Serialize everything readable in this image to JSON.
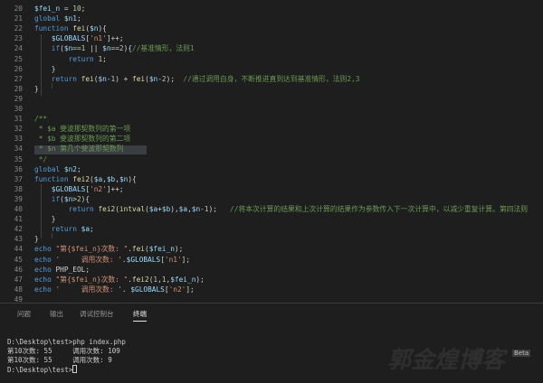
{
  "editor": {
    "lines": [
      {
        "n": "20",
        "tokens": [
          [
            "var",
            "$fei_n"
          ],
          [
            "op",
            " = "
          ],
          [
            "num",
            "10"
          ],
          [
            "op",
            ";"
          ]
        ]
      },
      {
        "n": "21",
        "tokens": [
          [
            "kw",
            "global"
          ],
          [
            "op",
            " "
          ],
          [
            "var",
            "$n1"
          ],
          [
            "op",
            ";"
          ]
        ]
      },
      {
        "n": "22",
        "tokens": [
          [
            "kw",
            "function"
          ],
          [
            "op",
            " "
          ],
          [
            "fn",
            "fei"
          ],
          [
            "op",
            "("
          ],
          [
            "var",
            "$n"
          ],
          [
            "op",
            "){"
          ]
        ]
      },
      {
        "n": "23",
        "tokens": [
          [
            "op",
            "    "
          ],
          [
            "var",
            "$GLOBALS"
          ],
          [
            "op",
            "["
          ],
          [
            "str",
            "'n1'"
          ],
          [
            "op",
            "]++;"
          ]
        ]
      },
      {
        "n": "24",
        "tokens": [
          [
            "op",
            "    "
          ],
          [
            "kw",
            "if"
          ],
          [
            "op",
            "("
          ],
          [
            "var",
            "$n"
          ],
          [
            "op",
            "=="
          ],
          [
            "num",
            "1"
          ],
          [
            "op",
            " || "
          ],
          [
            "var",
            "$n"
          ],
          [
            "op",
            "=="
          ],
          [
            "num",
            "2"
          ],
          [
            "op",
            "){"
          ],
          [
            "cmt",
            "//基准情形，法则1"
          ]
        ]
      },
      {
        "n": "25",
        "tokens": [
          [
            "op",
            "        "
          ],
          [
            "kw",
            "return"
          ],
          [
            "op",
            " "
          ],
          [
            "num",
            "1"
          ],
          [
            "op",
            ";"
          ]
        ]
      },
      {
        "n": "26",
        "tokens": [
          [
            "op",
            "    }"
          ]
        ]
      },
      {
        "n": "27",
        "tokens": [
          [
            "op",
            "    "
          ],
          [
            "kw",
            "return"
          ],
          [
            "op",
            " "
          ],
          [
            "fn",
            "fei"
          ],
          [
            "op",
            "("
          ],
          [
            "var",
            "$n"
          ],
          [
            "op",
            "-"
          ],
          [
            "num",
            "1"
          ],
          [
            "op",
            ") + "
          ],
          [
            "fn",
            "fei"
          ],
          [
            "op",
            "("
          ],
          [
            "var",
            "$n"
          ],
          [
            "op",
            "-"
          ],
          [
            "num",
            "2"
          ],
          [
            "op",
            ");  "
          ],
          [
            "cmt",
            "//通过调用自身，不断推进直到达到基准情形，法则2,3"
          ]
        ]
      },
      {
        "n": "28",
        "tokens": [
          [
            "op",
            "}"
          ]
        ]
      },
      {
        "n": "29",
        "tokens": []
      },
      {
        "n": "30",
        "tokens": []
      },
      {
        "n": "31",
        "tokens": [
          [
            "cmt",
            "/**"
          ]
        ]
      },
      {
        "n": "32",
        "tokens": [
          [
            "cmt",
            " * $a 斐波那契数列的第一项"
          ]
        ]
      },
      {
        "n": "33",
        "tokens": [
          [
            "cmt",
            " * $b 斐波那契数列的第二项"
          ]
        ]
      },
      {
        "n": "34",
        "tokens": [
          [
            "cmt",
            " * $n 第几个斐波那契数列"
          ]
        ]
      },
      {
        "n": "35",
        "tokens": [
          [
            "cmt",
            " */"
          ]
        ]
      },
      {
        "n": "36",
        "tokens": [
          [
            "kw",
            "global"
          ],
          [
            "op",
            " "
          ],
          [
            "var",
            "$n2"
          ],
          [
            "op",
            ";"
          ]
        ]
      },
      {
        "n": "37",
        "tokens": [
          [
            "kw",
            "function"
          ],
          [
            "op",
            " "
          ],
          [
            "fn",
            "fei2"
          ],
          [
            "op",
            "("
          ],
          [
            "var",
            "$a"
          ],
          [
            "op",
            ","
          ],
          [
            "var",
            "$b"
          ],
          [
            "op",
            ","
          ],
          [
            "var",
            "$n"
          ],
          [
            "op",
            "){"
          ]
        ]
      },
      {
        "n": "38",
        "tokens": [
          [
            "op",
            "    "
          ],
          [
            "var",
            "$GLOBALS"
          ],
          [
            "op",
            "["
          ],
          [
            "str",
            "'n2'"
          ],
          [
            "op",
            "]++;"
          ]
        ]
      },
      {
        "n": "39",
        "tokens": [
          [
            "op",
            "    "
          ],
          [
            "kw",
            "if"
          ],
          [
            "op",
            "("
          ],
          [
            "var",
            "$n"
          ],
          [
            "op",
            ">"
          ],
          [
            "num",
            "2"
          ],
          [
            "op",
            "){"
          ]
        ]
      },
      {
        "n": "40",
        "tokens": [
          [
            "op",
            "        "
          ],
          [
            "kw",
            "return"
          ],
          [
            "op",
            " "
          ],
          [
            "fn",
            "fei2"
          ],
          [
            "op",
            "("
          ],
          [
            "fn",
            "intval"
          ],
          [
            "op",
            "("
          ],
          [
            "var",
            "$a"
          ],
          [
            "op",
            "+"
          ],
          [
            "var",
            "$b"
          ],
          [
            "op",
            "),"
          ],
          [
            "var",
            "$a"
          ],
          [
            "op",
            ","
          ],
          [
            "var",
            "$n"
          ],
          [
            "op",
            "-"
          ],
          [
            "num",
            "1"
          ],
          [
            "op",
            ");   "
          ],
          [
            "cmt",
            "//将本次计算的结果和上次计算的结果作为参数传入下一次计算中，以减少重复计算。第四法则"
          ]
        ]
      },
      {
        "n": "41",
        "tokens": [
          [
            "op",
            "    }"
          ]
        ]
      },
      {
        "n": "42",
        "tokens": [
          [
            "op",
            "    "
          ],
          [
            "kw",
            "return"
          ],
          [
            "op",
            " "
          ],
          [
            "var",
            "$a"
          ],
          [
            "op",
            ";"
          ]
        ]
      },
      {
        "n": "43",
        "tokens": [
          [
            "op",
            "}"
          ]
        ]
      },
      {
        "n": "44",
        "tokens": [
          [
            "kw",
            "echo"
          ],
          [
            "op",
            " "
          ],
          [
            "str",
            "\"第{$fei_n}次数: \""
          ],
          [
            "op",
            "."
          ],
          [
            "fn",
            "fei"
          ],
          [
            "op",
            "("
          ],
          [
            "var",
            "$fei_n"
          ],
          [
            "op",
            ");"
          ]
        ]
      },
      {
        "n": "45",
        "tokens": [
          [
            "kw",
            "echo"
          ],
          [
            "op",
            " "
          ],
          [
            "str",
            "'     调用次数: '"
          ],
          [
            "op",
            "."
          ],
          [
            "var",
            "$GLOBALS"
          ],
          [
            "op",
            "["
          ],
          [
            "str",
            "'n1'"
          ],
          [
            "op",
            "];"
          ]
        ]
      },
      {
        "n": "46",
        "tokens": [
          [
            "kw",
            "echo"
          ],
          [
            "op",
            " PHP_EOL;"
          ]
        ]
      },
      {
        "n": "47",
        "tokens": [
          [
            "kw",
            "echo"
          ],
          [
            "op",
            " "
          ],
          [
            "str",
            "\"第{$fei_n}次数: \""
          ],
          [
            "op",
            "."
          ],
          [
            "fn",
            "fei2"
          ],
          [
            "op",
            "("
          ],
          [
            "num",
            "1"
          ],
          [
            "op",
            ","
          ],
          [
            "num",
            "1"
          ],
          [
            "op",
            ","
          ],
          [
            "var",
            "$fei_n"
          ],
          [
            "op",
            ");"
          ]
        ]
      },
      {
        "n": "48",
        "tokens": [
          [
            "kw",
            "echo"
          ],
          [
            "op",
            " "
          ],
          [
            "str",
            "'     调用次数: '"
          ],
          [
            "op",
            ". "
          ],
          [
            "var",
            "$GLOBALS"
          ],
          [
            "op",
            "["
          ],
          [
            "str",
            "'n2'"
          ],
          [
            "op",
            "];"
          ]
        ]
      },
      {
        "n": "49",
        "tokens": []
      }
    ]
  },
  "panel": {
    "tabs": [
      {
        "label": "问题",
        "active": false
      },
      {
        "label": "输出",
        "active": false
      },
      {
        "label": "调试控制台",
        "active": false
      },
      {
        "label": "终端",
        "active": true
      }
    ],
    "terminal": {
      "lines": [
        "D:\\Desktop\\test>php index.php",
        "第10次数: 55     调用次数: 109",
        "第10次数: 55     调用次数: 9",
        "D:\\Desktop\\test>"
      ]
    }
  },
  "watermark": {
    "text": "郭金煌博客",
    "badge": "Beta"
  }
}
